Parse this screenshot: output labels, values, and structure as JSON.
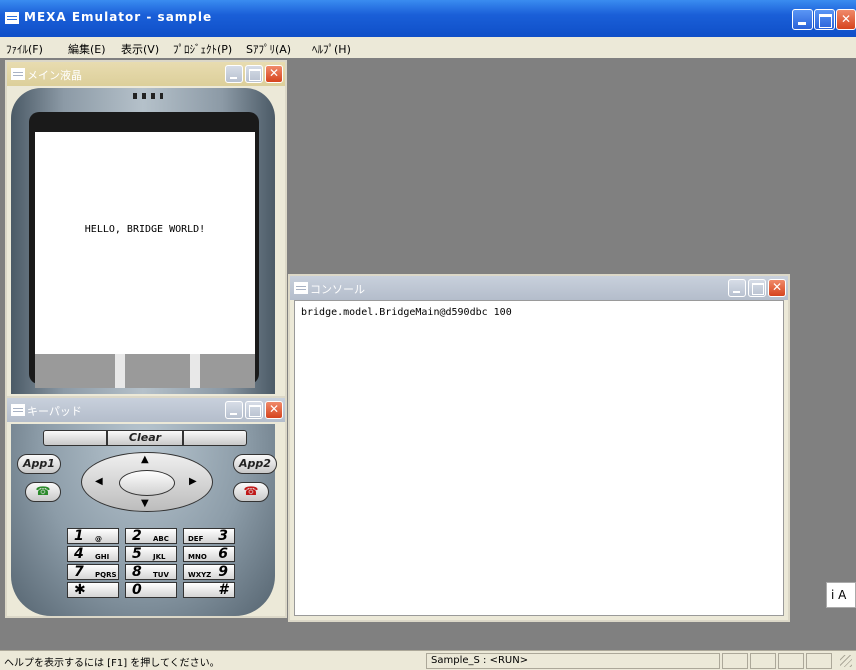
{
  "app": {
    "title": "MEXA Emulator - sample",
    "close_glyph": "✕"
  },
  "menu": [
    {
      "label": "ﾌｧｲﾙ(F)"
    },
    {
      "label": "編集(E)"
    },
    {
      "label": "表示(V)"
    },
    {
      "label": "ﾌﾟﾛｼﾞｪｸﾄ(P)"
    },
    {
      "label": "Sｱﾌﾟﾘ(A)"
    },
    {
      "label": "ﾍﾙﾌﾟ(H)"
    }
  ],
  "lcd_window": {
    "title": "メイン液晶",
    "screen_text": "HELLO, BRIDGE WORLD!"
  },
  "keypad_window": {
    "title": "キーパッド",
    "clear_label": "Clear",
    "app1_label": "App1",
    "app2_label": "App2",
    "keys": [
      {
        "digit": "1",
        "sub": "@"
      },
      {
        "digit": "2",
        "sub": "ABC"
      },
      {
        "digit": "3",
        "sub": "DEF"
      },
      {
        "digit": "4",
        "sub": "GHI"
      },
      {
        "digit": "5",
        "sub": "JKL"
      },
      {
        "digit": "6",
        "sub": "MNO"
      },
      {
        "digit": "7",
        "sub": "PQRS"
      },
      {
        "digit": "8",
        "sub": "TUV"
      },
      {
        "digit": "9",
        "sub": "WXYZ"
      },
      {
        "digit": "✱",
        "sub": ""
      },
      {
        "digit": "0",
        "sub": ""
      },
      {
        "digit": "#",
        "sub": ""
      }
    ]
  },
  "console_window": {
    "title": "コンソール",
    "output": "bridge.model.BridgeMain@d590dbc 100"
  },
  "minimized_window": {
    "label": "i A"
  },
  "statusbar": {
    "help_text": "ヘルプを表示するには [F1] を押してください。",
    "app_status": "Sample_S : <RUN>"
  },
  "icons": {
    "app_icon": "window-menu-icon",
    "dpad_up": "▲",
    "dpad_down": "▼",
    "dpad_left": "◀",
    "dpad_right": "▶"
  }
}
